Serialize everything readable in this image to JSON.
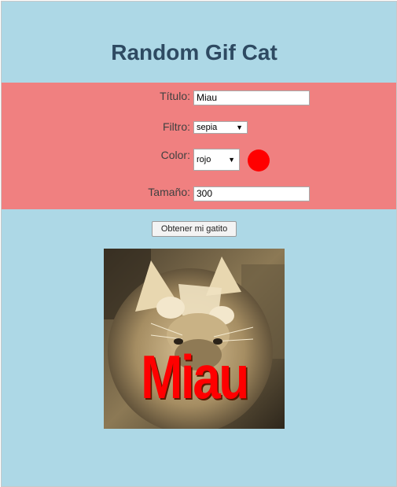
{
  "page": {
    "title": "Random Gif Cat"
  },
  "form": {
    "title_label": "Título:",
    "title_value": "Miau",
    "filter_label": "Filtro:",
    "filter_value": "sepia",
    "color_label": "Color:",
    "color_value": "rojo",
    "color_swatch": "#ff0000",
    "size_label": "Tamaño:",
    "size_value": "300"
  },
  "actions": {
    "get_cat_label": "Obtener mi gatito"
  },
  "image": {
    "caption": "Miau",
    "filter": "sepia"
  },
  "colors": {
    "background": "#add8e6",
    "panel": "#f08080",
    "title_text": "#2e4a62",
    "caption_text": "#ff0000"
  }
}
